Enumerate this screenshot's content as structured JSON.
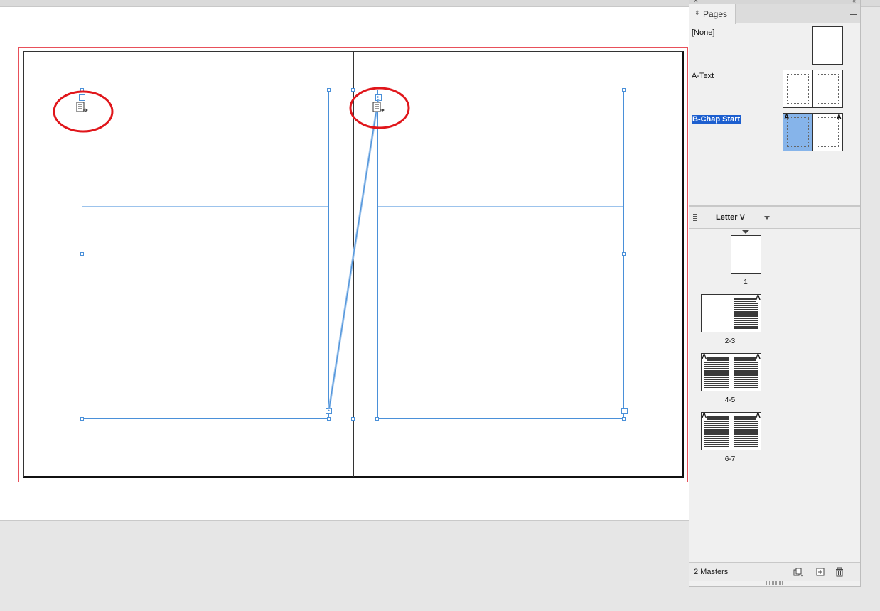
{
  "pages_panel": {
    "tab_label": "Pages",
    "masters": [
      {
        "name": "[None]"
      },
      {
        "name": "A-Text"
      },
      {
        "name": "B-Chap Start",
        "selected": true
      }
    ],
    "page_size": "Letter V",
    "page_thumbnails": [
      {
        "label": "1",
        "master_letters": []
      },
      {
        "label": "2-3",
        "master_letters": [
          "A"
        ]
      },
      {
        "label": "4-5",
        "master_letters": [
          "A",
          "A"
        ]
      },
      {
        "label": "6-7",
        "master_letters": [
          "A",
          "A"
        ]
      }
    ],
    "master_thumb_letters": {
      "left": "A",
      "right": "A"
    },
    "footer_label": "2 Masters"
  },
  "colors": {
    "frame_blue": "#4a90d9",
    "annotation_red": "#e0161b",
    "bleed_red": "#e8505a",
    "selection_blue": "#1d5fcf",
    "master_highlight": "#86b4ea"
  },
  "icons": {
    "tab": "sort-arrows-icon",
    "panel_menu": "hamburger-menu-icon",
    "footer": [
      "new-page-icon",
      "create-new-page-icon",
      "trash-icon"
    ]
  }
}
